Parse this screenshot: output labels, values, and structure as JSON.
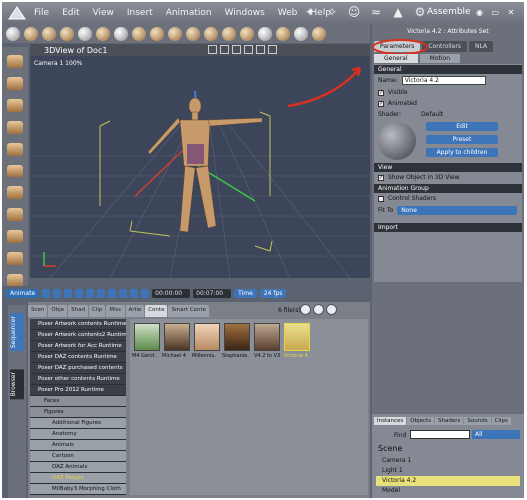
{
  "menubar": {
    "items": [
      "File",
      "Edit",
      "View",
      "Insert",
      "Animation",
      "Windows",
      "Web",
      "Help"
    ],
    "room": "Assemble",
    "room_icons": "◉ ▭ ✕"
  },
  "viewport": {
    "title": "3DView of Doc1",
    "camera_label": "Camera 1 100%"
  },
  "animation": {
    "label": "Animate",
    "start_time": "00:00:00",
    "end_time": "00:07:00",
    "time_mode": "Time",
    "fps": "24 fps"
  },
  "library": {
    "side_tabs": [
      "Sequencer",
      "Browser"
    ],
    "tabs": [
      "Scen",
      "Obje",
      "Shad",
      "Clip",
      "Misc",
      "Artw",
      "Conte",
      "Smart Conte"
    ],
    "active_tab": "Conte",
    "file_count": "6 file(s)",
    "tree": [
      {
        "label": "Poser Artwork contents Runtime",
        "lvl": 0
      },
      {
        "label": "Poser Artwork contents2 Runtime",
        "lvl": 0
      },
      {
        "label": "Poser Artwork for Acc Runtime",
        "lvl": 0
      },
      {
        "label": "Poser DAZ contents Runtime",
        "lvl": 0
      },
      {
        "label": "Poser DAZ purchased contents",
        "lvl": 0
      },
      {
        "label": "Poser other contents Runtime",
        "lvl": 0
      },
      {
        "label": "Poser Pro 2012 Runtime",
        "lvl": 0
      },
      {
        "label": "Faces",
        "lvl": 1
      },
      {
        "label": "Figures",
        "lvl": 1
      },
      {
        "label": "Additional Figures",
        "lvl": 2
      },
      {
        "label": "Anatomy",
        "lvl": 2
      },
      {
        "label": "Animals",
        "lvl": 2
      },
      {
        "label": "Cartoon",
        "lvl": 2
      },
      {
        "label": "DAZ Animals",
        "lvl": 2
      },
      {
        "label": "DAZ People",
        "lvl": 2,
        "hi": true
      },
      {
        "label": "MilBaby3 Morphing Cloth",
        "lvl": 2
      }
    ],
    "items": [
      "M4 Genit.",
      "Michael 4",
      "Millenniu.",
      "Stephanie.",
      "V4.2 to V3",
      "Victoria 4."
    ]
  },
  "params": {
    "title": "Victoria 4.2 : Attributes Set",
    "tabs": [
      "Parameters",
      "Controllers",
      "NLA"
    ],
    "subtabs": [
      "General",
      "Motion"
    ],
    "sections": {
      "general": "General",
      "view": "View",
      "anim": "Animation Group",
      "import": "Import"
    },
    "name_label": "Name:",
    "name_value": "Victoria 4.2",
    "visible": "Visible",
    "animated": "Animated",
    "shader_label": "Shader:",
    "shader_value": "Default",
    "buttons": [
      "Edit",
      "Preset",
      "Apply to children"
    ],
    "show_object": "Show Object in 3D View",
    "control_shaders": "Control Shaders",
    "fit_to_label": "Fit To",
    "fit_to_value": "None"
  },
  "scene": {
    "tabs": [
      "Instances",
      "Objects",
      "Shaders",
      "Sounds",
      "Clips"
    ],
    "find_label": "Find",
    "filter": "All",
    "title": "Scene",
    "items": [
      "Camera 1",
      "Light 1",
      "Victoria 4.2",
      "Model"
    ]
  },
  "colors": {
    "accent": "#3e74b8",
    "annotation": "#d8321e",
    "highlight": "#e8d24a"
  }
}
